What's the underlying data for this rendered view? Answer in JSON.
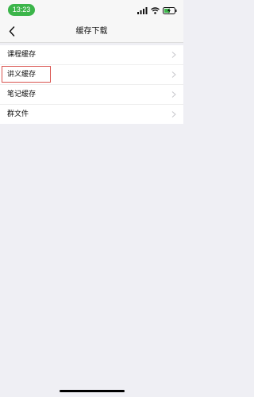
{
  "status_bar": {
    "time": "13:23",
    "icons": [
      "signal-icon",
      "wifi-icon",
      "battery-charging-icon"
    ]
  },
  "nav": {
    "back_icon": "chevron-left-icon",
    "title": "缓存下载"
  },
  "list": {
    "items": [
      {
        "label": "课程缓存"
      },
      {
        "label": "讲义缓存"
      },
      {
        "label": "笔记缓存"
      },
      {
        "label": "群文件"
      }
    ]
  },
  "colors": {
    "time_pill": "#3bb54a",
    "highlight": "#d9534f",
    "background": "#efeff4"
  }
}
